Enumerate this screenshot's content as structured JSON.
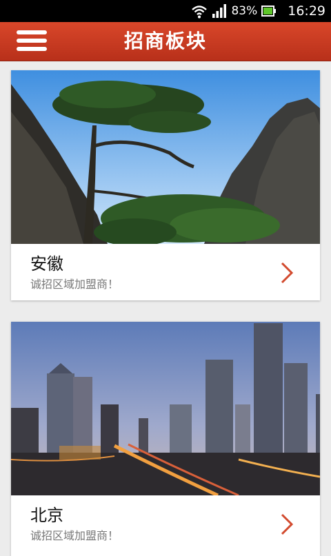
{
  "status_bar": {
    "battery": "83%",
    "time": "16:29"
  },
  "app_bar": {
    "title": "招商板块"
  },
  "regions": [
    {
      "name": "安徽",
      "subtitle": "诚招区域加盟商！"
    },
    {
      "name": "北京",
      "subtitle": "诚招区域加盟商！"
    }
  ],
  "colors": {
    "app_bar": "#c63b22",
    "chevron": "#d24a2e",
    "background": "#ececec"
  }
}
